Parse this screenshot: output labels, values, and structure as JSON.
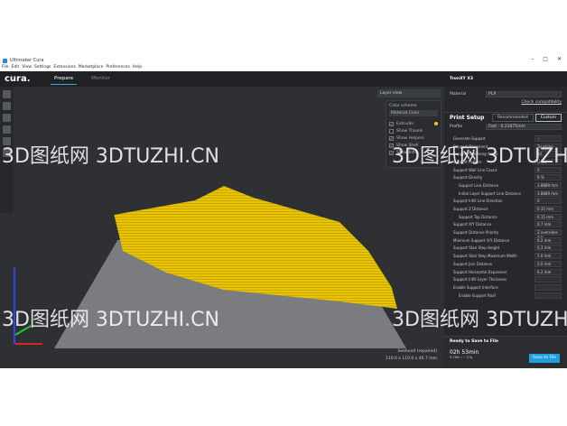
{
  "window": {
    "title": "Ultimaker Cura",
    "controls": [
      "–",
      "□",
      "✕"
    ]
  },
  "menu": [
    "File",
    "Edit",
    "View",
    "Settings",
    "Extensions",
    "Marketplace",
    "Preferences",
    "Help"
  ],
  "header": {
    "brand": "cura.",
    "stages": [
      "Prepare",
      "Monitor"
    ]
  },
  "viewport": {
    "view_mode": "Layer view",
    "color_scheme_label": "Color scheme",
    "color_scheme": "Material Color",
    "checks": [
      {
        "label": "Extruder",
        "checked": true
      },
      {
        "label": "Show Travels",
        "checked": false
      },
      {
        "label": "Show Helpers",
        "checked": true
      },
      {
        "label": "Show Shell",
        "checked": true
      },
      {
        "label": "Show Infill",
        "checked": true
      }
    ],
    "extruder_color": "#f0d000",
    "object_name": "Seehund (repaired)",
    "object_dims": "110.0 x 110.0 x 46.7 mm"
  },
  "sidebar": {
    "printer": "TronXY X3",
    "material_label": "Material",
    "material": "PLA",
    "compat": "Check compatibility",
    "print_setup": "Print Setup",
    "tabs": [
      "Recommended",
      "Custom"
    ],
    "profile_label": "Profile",
    "profile": "Fast - 0.21875mm",
    "settings": [
      {
        "label": "Generate Support",
        "value": "✓",
        "sub": false
      },
      {
        "label": "Support Placement",
        "value": "Touching Build...",
        "sub": false
      },
      {
        "label": "Support Overhang Angle",
        "value": "50",
        "sub": false
      },
      {
        "label": "Support Pattern",
        "value": "Lines",
        "sub": false
      },
      {
        "label": "Support Wall Line Count",
        "value": "0",
        "sub": false
      },
      {
        "label": "Support Density",
        "value": "9 %",
        "sub": false
      },
      {
        "label": "Support Line Distance",
        "value": "3.8889 mm",
        "sub": true
      },
      {
        "label": "Initial Layer Support Line Distance",
        "value": "3.8889 mm",
        "sub": true
      },
      {
        "label": "Support Infill Line Direction",
        "value": "0",
        "sub": false
      },
      {
        "label": "Support Z Distance",
        "value": "0.15 mm",
        "sub": false
      },
      {
        "label": "Support Top Distance",
        "value": "0.15 mm",
        "sub": true
      },
      {
        "label": "Support X/Y Distance",
        "value": "0.7 mm",
        "sub": false
      },
      {
        "label": "Support Distance Priority",
        "value": "Z overrides X/Y",
        "sub": false
      },
      {
        "label": "Minimum Support X/Y Distance",
        "value": "0.2 mm",
        "sub": false
      },
      {
        "label": "Support Stair Step Height",
        "value": "0.3 mm",
        "sub": false
      },
      {
        "label": "Support Stair Step Maximum Width",
        "value": "5.0 mm",
        "sub": false
      },
      {
        "label": "Support Join Distance",
        "value": "2.0 mm",
        "sub": false
      },
      {
        "label": "Support Horizontal Expansion",
        "value": "0.2 mm",
        "sub": false
      },
      {
        "label": "Support Infill Layer Thickness",
        "value": "",
        "sub": false
      },
      {
        "label": "Enable Support Interface",
        "value": "",
        "sub": false
      },
      {
        "label": "Enable Support Roof",
        "value": "",
        "sub": true
      }
    ],
    "save_title": "Ready to Save to File",
    "time": "02h 53min",
    "usage": "9.16m / ~ 27g",
    "save_button": "Save to File"
  },
  "watermark": "3D图纸网 3DTUZHI.CN"
}
